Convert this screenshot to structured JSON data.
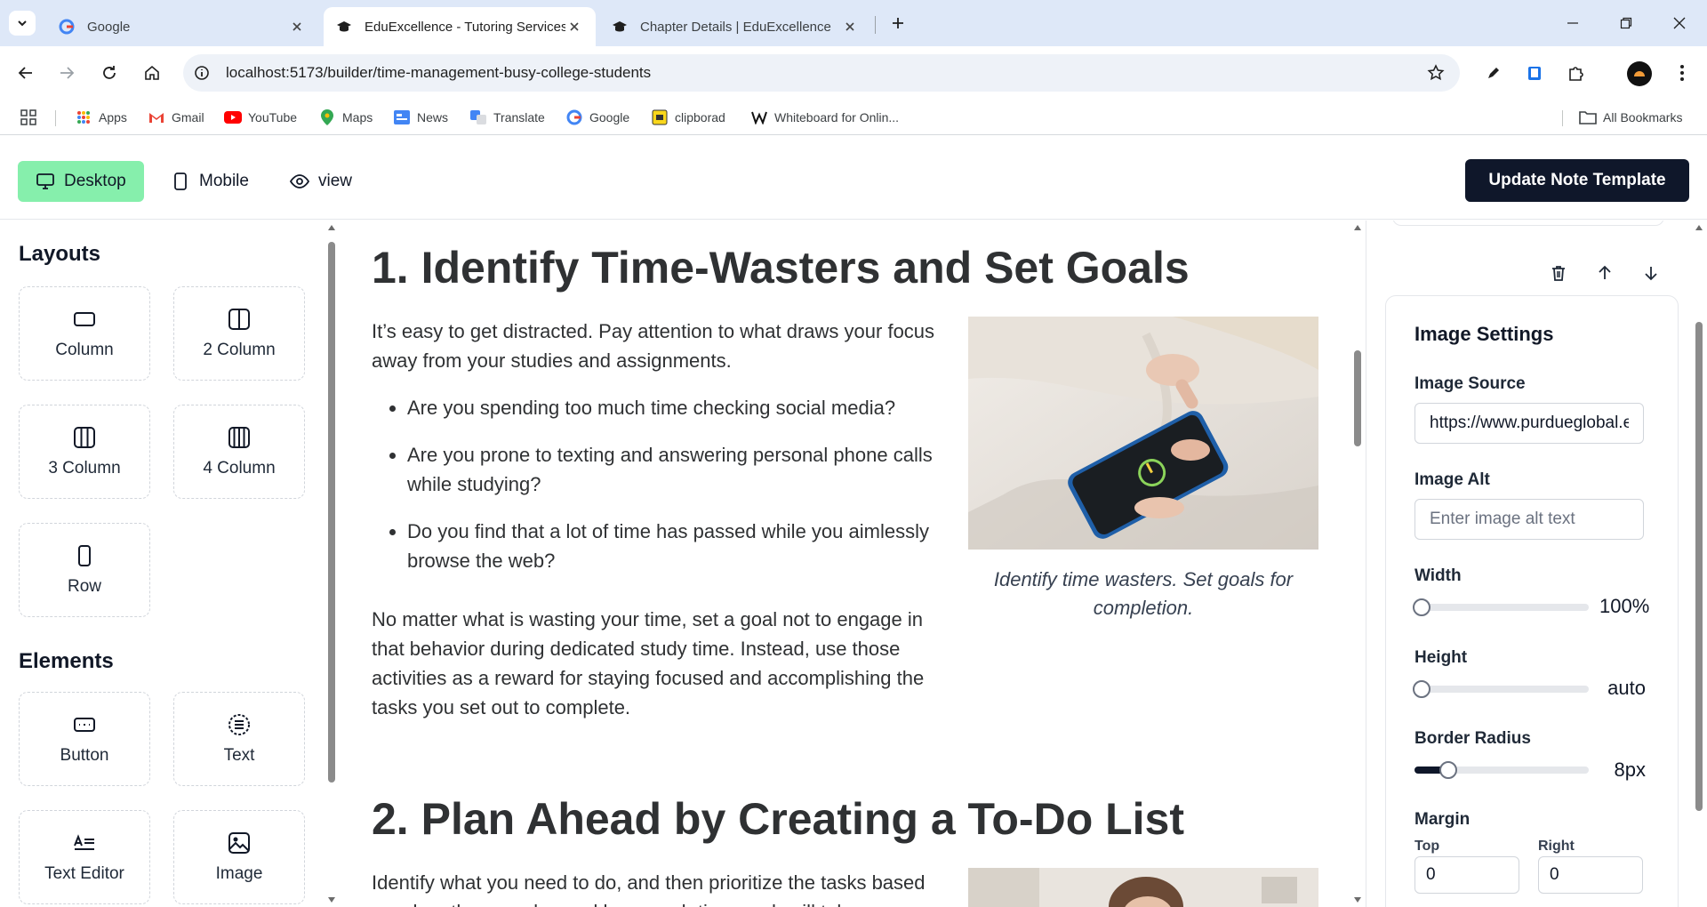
{
  "browser": {
    "tabs": [
      {
        "title": "Google",
        "icon": "google-icon"
      },
      {
        "title": "EduExcellence - Tutoring Services",
        "icon": "graduation-cap-icon"
      },
      {
        "title": "Chapter Details | EduExcellence",
        "icon": "graduation-cap-icon"
      }
    ],
    "url": "localhost:5173/builder/time-management-busy-college-students",
    "bookmarks": [
      {
        "label": "Apps",
        "icon": "apps-grid-icon"
      },
      {
        "label": "Gmail",
        "icon": "gmail-icon"
      },
      {
        "label": "YouTube",
        "icon": "youtube-icon"
      },
      {
        "label": "Maps",
        "icon": "maps-pin-icon"
      },
      {
        "label": "News",
        "icon": "news-icon"
      },
      {
        "label": "Translate",
        "icon": "translate-icon"
      },
      {
        "label": "Google",
        "icon": "google-icon"
      },
      {
        "label": "clipborad",
        "icon": "clipboard-icon"
      },
      {
        "label": "Whiteboard for Onlin...",
        "icon": "whiteboard-w-icon"
      }
    ],
    "all_bookmarks": "All Bookmarks"
  },
  "header": {
    "modes": [
      "Desktop",
      "Mobile",
      "view"
    ],
    "update_button": "Update Note Template"
  },
  "sidebar": {
    "layouts_title": "Layouts",
    "layouts": [
      "Column",
      "2 Column",
      "3 Column",
      "4 Column",
      "Row"
    ],
    "elements_title": "Elements",
    "elements": [
      "Button",
      "Text",
      "Text Editor",
      "Image"
    ]
  },
  "canvas": {
    "section1": {
      "heading": "1. Identify Time-Wasters and Set Goals",
      "intro": "It’s easy to get distracted. Pay attention to what draws your focus away from your studies and assignments.",
      "bullets": [
        "Are you spending too much time checking social media?",
        "Are you prone to texting and answering personal phone calls while studying?",
        "Do you find that a lot of time has passed while you aimlessly browse the web?"
      ],
      "closing": "No matter what is wasting your time, set a goal not to engage in that behavior during dedicated study time. Instead, use those activities as a reward for staying focused and accomplishing the tasks you set out to complete.",
      "caption": "Identify time wasters. Set goals for completion."
    },
    "section2": {
      "heading": "2. Plan Ahead by Creating a To-Do List",
      "intro": "Identify what you need to do, and then prioritize the tasks based on when they are due and how much time each will take."
    }
  },
  "settings": {
    "title": "Image Settings",
    "image_source_label": "Image Source",
    "image_source_value": "https://www.purdueglobal.edu/blog/student-life/time-management-busy-college-students.jpg",
    "image_alt_label": "Image Alt",
    "image_alt_placeholder": "Enter image alt text",
    "width_label": "Width",
    "width_value": "100%",
    "height_label": "Height",
    "height_value": "auto",
    "border_radius_label": "Border Radius",
    "border_radius_value": "8px",
    "margin_label": "Margin",
    "margin_top_label": "Top",
    "margin_top_value": "0",
    "margin_right_label": "Right",
    "margin_right_value": "0"
  },
  "colors": {
    "active_mode": "#86efac",
    "primary_dark": "#0f172a",
    "chrome_bg": "#dee8f8"
  }
}
